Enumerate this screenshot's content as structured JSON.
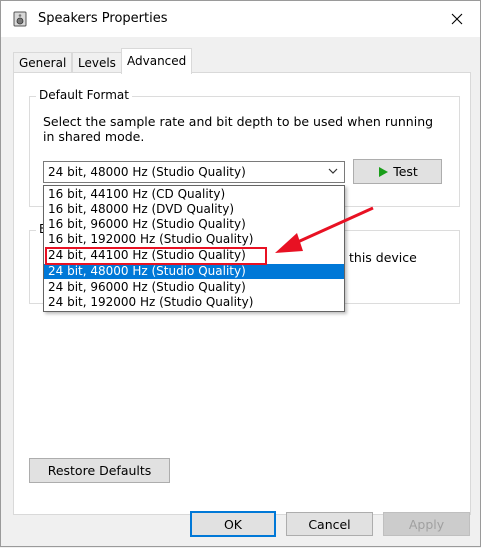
{
  "window": {
    "title": "Speakers Properties"
  },
  "tabs": [
    {
      "label": "General"
    },
    {
      "label": "Levels"
    },
    {
      "label": "Advanced"
    }
  ],
  "default_format": {
    "legend": "Default Format",
    "description": "Select the sample rate and bit depth to be used when running in shared mode.",
    "selected_value": "24 bit, 48000 Hz (Studio Quality)",
    "test_label": "Test",
    "options": [
      "16 bit, 44100 Hz (CD Quality)",
      "16 bit, 48000 Hz (DVD Quality)",
      "16 bit, 96000 Hz (Studio Quality)",
      "16 bit, 192000 Hz (Studio Quality)",
      "24 bit, 44100 Hz (Studio Quality)",
      "24 bit, 48000 Hz (Studio Quality)",
      "24 bit, 96000 Hz (Studio Quality)",
      "24 bit, 192000 Hz (Studio Quality)"
    ],
    "highlighted_index": 5,
    "annotated_index": 4
  },
  "exclusive_group": {
    "legend_fragment": "E",
    "text_fragment": "this device"
  },
  "restore_defaults_label": "Restore Defaults",
  "footer": {
    "ok_label": "OK",
    "cancel_label": "Cancel",
    "apply_label": "Apply"
  },
  "colors": {
    "selection": "#0078d7",
    "annotation": "#e81123",
    "test_icon": "#1a9e1a"
  }
}
